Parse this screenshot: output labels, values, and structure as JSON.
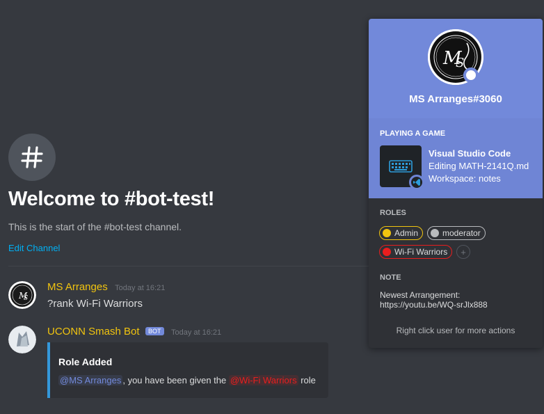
{
  "channel": {
    "icon": "hash-icon",
    "welcome_title": "Welcome to #bot-test!",
    "welcome_subtitle": "This is the start of the #bot-test channel.",
    "edit_channel_label": "Edit Channel"
  },
  "messages": [
    {
      "author": "MS Arranges",
      "timestamp": "Today at 16:21",
      "content": "?rank Wi-Fi Warriors",
      "author_color": "#f1c40f"
    },
    {
      "author": "UCONN Smash Bot",
      "bot_tag": "BOT",
      "timestamp": "Today at 16:21",
      "author_color": "#f1c40f",
      "embed": {
        "title": "Role Added",
        "mention_user": "@MS Arranges",
        "text_middle": ", you have been given the ",
        "mention_role": "@Wi-Fi Warriors",
        "text_end": " role",
        "accent_color": "#3498db"
      }
    }
  ],
  "popout": {
    "username": "MS Arranges#3060",
    "status": "online",
    "activity": {
      "label": "PLAYING A GAME",
      "name": "Visual Studio Code",
      "details": "Editing MATH-2141Q.md",
      "state": "Workspace: notes",
      "icon": "keyboard-icon",
      "badge_icon": "vscode-icon"
    },
    "roles_label": "ROLES",
    "roles": [
      {
        "name": "Admin",
        "color": "#f1c40f"
      },
      {
        "name": "moderator",
        "color": "#b9bbbe"
      },
      {
        "name": "Wi-Fi Warriors",
        "color": "#e91e1e"
      }
    ],
    "add_role_label": "+",
    "note_label": "NOTE",
    "note_line1": "Newest Arrangement:",
    "note_line2": "https://youtu.be/WQ-srJlx888",
    "footer_hint": "Right click user for more actions"
  },
  "colors": {
    "background": "#36393f",
    "popout_background": "#2f3136",
    "popout_header": "#7289da",
    "link": "#00b0f4"
  }
}
